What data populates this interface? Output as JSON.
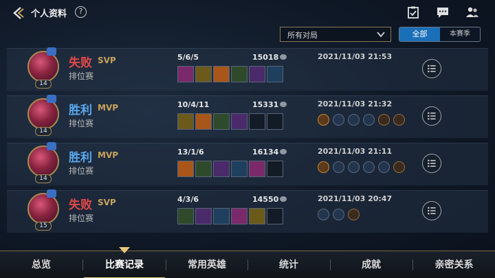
{
  "header": {
    "title": "个人资料",
    "help_label": "?",
    "colors": {
      "accent": "#c9a25a",
      "brand": "#1a6fb8"
    }
  },
  "filters": {
    "mode_select": "所有对局",
    "seg_all": "全部",
    "seg_season": "本赛季"
  },
  "matches": [
    {
      "result": "失败",
      "result_type": "lose",
      "honor": "SVP",
      "mode": "排位赛",
      "level": "14",
      "kda": "5/6/5",
      "gold": "15018",
      "date": "2021/11/03 21:53",
      "items_filled": 6,
      "runes": []
    },
    {
      "result": "胜利",
      "result_type": "win",
      "honor": "MVP",
      "mode": "排位赛",
      "level": "14",
      "kda": "10/4/11",
      "gold": "15331",
      "date": "2021/11/03 21:32",
      "items_filled": 4,
      "runes": [
        "gold",
        "blue",
        "blue",
        "blue",
        "bronze",
        "bronze"
      ]
    },
    {
      "result": "胜利",
      "result_type": "win",
      "honor": "MVP",
      "mode": "排位赛",
      "level": "14",
      "kda": "13/1/6",
      "gold": "16134",
      "date": "2021/11/03 21:11",
      "items_filled": 5,
      "runes": [
        "gold",
        "blue",
        "blue",
        "blue",
        "blue",
        "bronze"
      ]
    },
    {
      "result": "失败",
      "result_type": "lose",
      "honor": "SVP",
      "mode": "排位赛",
      "level": "15",
      "kda": "4/3/6",
      "gold": "14550",
      "date": "2021/11/03 20:47",
      "items_filled": 5,
      "runes": [
        "blue",
        "blue",
        "bronze"
      ]
    }
  ],
  "nav": {
    "items": [
      "总览",
      "比赛记录",
      "常用英雄",
      "统计",
      "成就",
      "亲密关系"
    ],
    "active": "比赛记录"
  }
}
